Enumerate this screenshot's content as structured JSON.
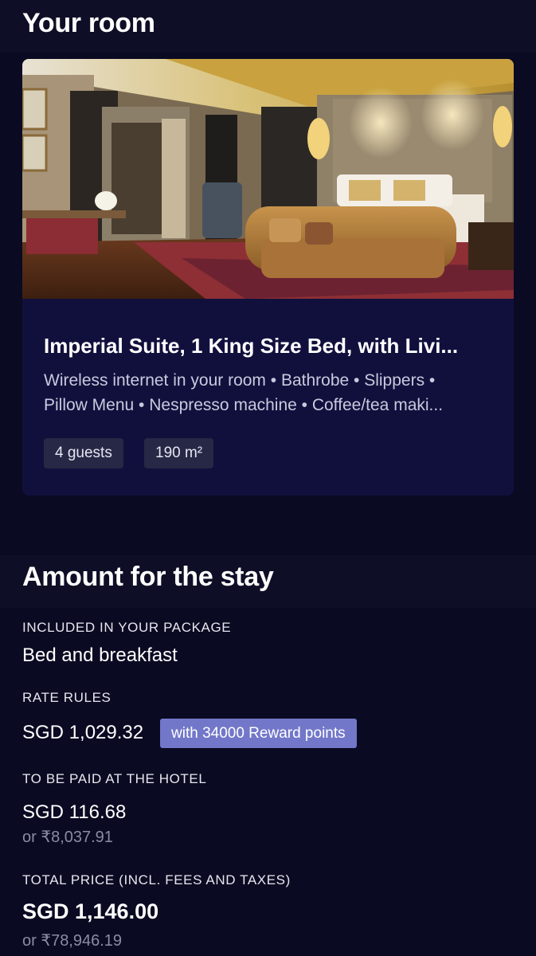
{
  "room_section": {
    "title": "Your room",
    "room": {
      "name": "Imperial Suite, 1 King Size Bed, with Livi...",
      "amenities_line1": "Wireless internet in your room • Bathrobe • Slippers •",
      "amenities_line2": "Pillow Menu • Nespresso machine • Coffee/tea maki...",
      "guests": "4 guests",
      "size": "190 m²"
    }
  },
  "amount_section": {
    "title": "Amount for the stay",
    "included_label": "INCLUDED IN YOUR PACKAGE",
    "included_value": "Bed and breakfast",
    "rate_label": "RATE RULES",
    "rate_value": "SGD 1,029.32",
    "reward_badge": "with 34000 Reward points",
    "hotel_label": "TO BE PAID AT THE HOTEL",
    "hotel_value": "SGD 116.68",
    "hotel_alt": "or  ₹8,037.91",
    "total_label": "TOTAL PRICE (INCL. FEES AND TAXES)",
    "total_value": "SGD 1,146.00",
    "total_alt": "or  ₹78,946.19"
  },
  "colors": {
    "background": "#0a0a22",
    "card": "#11103d",
    "badge": "#7277c9"
  }
}
